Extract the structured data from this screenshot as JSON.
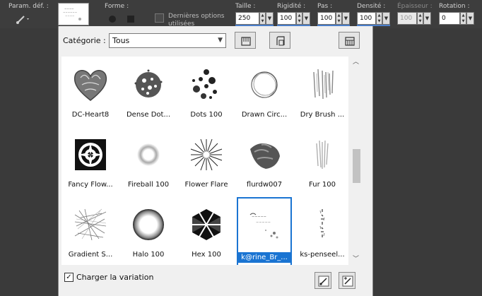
{
  "toolbar": {
    "preset_label": "Param. déf. :",
    "shape_label": "Forme :",
    "stepped_label": "Dernières options utilisées",
    "size": {
      "label": "Taille :",
      "value": "250"
    },
    "hardness": {
      "label": "Rigidité :",
      "value": "100"
    },
    "step": {
      "label": "Pas :",
      "value": "100"
    },
    "density": {
      "label": "Densité :",
      "value": "100"
    },
    "thickness": {
      "label": "Épaisseur :",
      "value": "100"
    },
    "rotation": {
      "label": "Rotation :",
      "value": "0"
    }
  },
  "panel": {
    "category_label": "Catégorie :",
    "category_value": "Tous",
    "variation_label": "Charger la variation",
    "variation_checked": true,
    "brushes": [
      {
        "name": "DC-Heart8",
        "icon": "heart-brush-icon"
      },
      {
        "name": "Dense Dot...",
        "icon": "dense-dots-brush-icon"
      },
      {
        "name": "Dots 100",
        "icon": "dots-brush-icon"
      },
      {
        "name": "Drawn Circ...",
        "icon": "drawn-circle-brush-icon"
      },
      {
        "name": "Dry Brush ...",
        "icon": "dry-brush-icon"
      },
      {
        "name": "Fancy Flow...",
        "icon": "fancy-flower-brush-icon"
      },
      {
        "name": "Fireball 100",
        "icon": "fireball-brush-icon"
      },
      {
        "name": "Flower Flare",
        "icon": "flower-flare-brush-icon"
      },
      {
        "name": "flurdw007",
        "icon": "flurdw-brush-icon"
      },
      {
        "name": "Fur 100",
        "icon": "fur-brush-icon"
      },
      {
        "name": "Gradient S...",
        "icon": "gradient-scribble-brush-icon"
      },
      {
        "name": "Halo 100",
        "icon": "halo-brush-icon"
      },
      {
        "name": "Hex 100",
        "icon": "hex-brush-icon"
      },
      {
        "name": "k@rine_Br_...",
        "icon": "karine-brush-icon",
        "selected": true
      },
      {
        "name": "ks-penseel...",
        "icon": "ks-penseel-brush-icon"
      }
    ]
  },
  "colors": {
    "selection": "#1a74d2",
    "accent_underline": "#4a7ec9"
  }
}
